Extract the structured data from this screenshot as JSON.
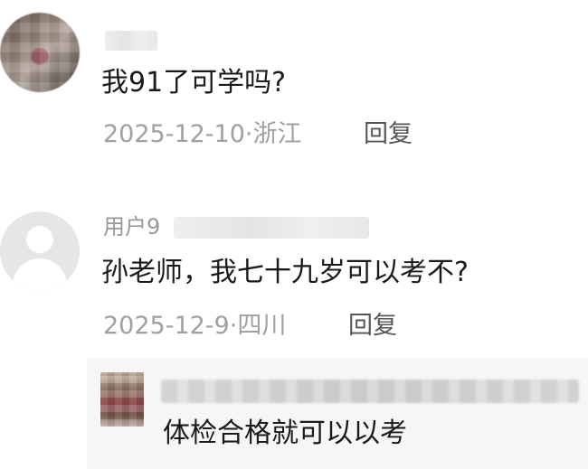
{
  "comments": [
    {
      "text": "我91了可学吗?",
      "date": "2025-12-10",
      "separator": "·",
      "location": "浙江",
      "reply_label": "回复"
    },
    {
      "username_prefix": "用户9",
      "text": "孙老师，我七十九岁可以考不?",
      "date": "2025-12-9",
      "separator": "·",
      "location": "四川",
      "reply_label": "回复",
      "replies": [
        {
          "text": "体检合格就可以以考"
        }
      ]
    }
  ],
  "icons": {
    "avatar_default": "user-silhouette-icon"
  }
}
